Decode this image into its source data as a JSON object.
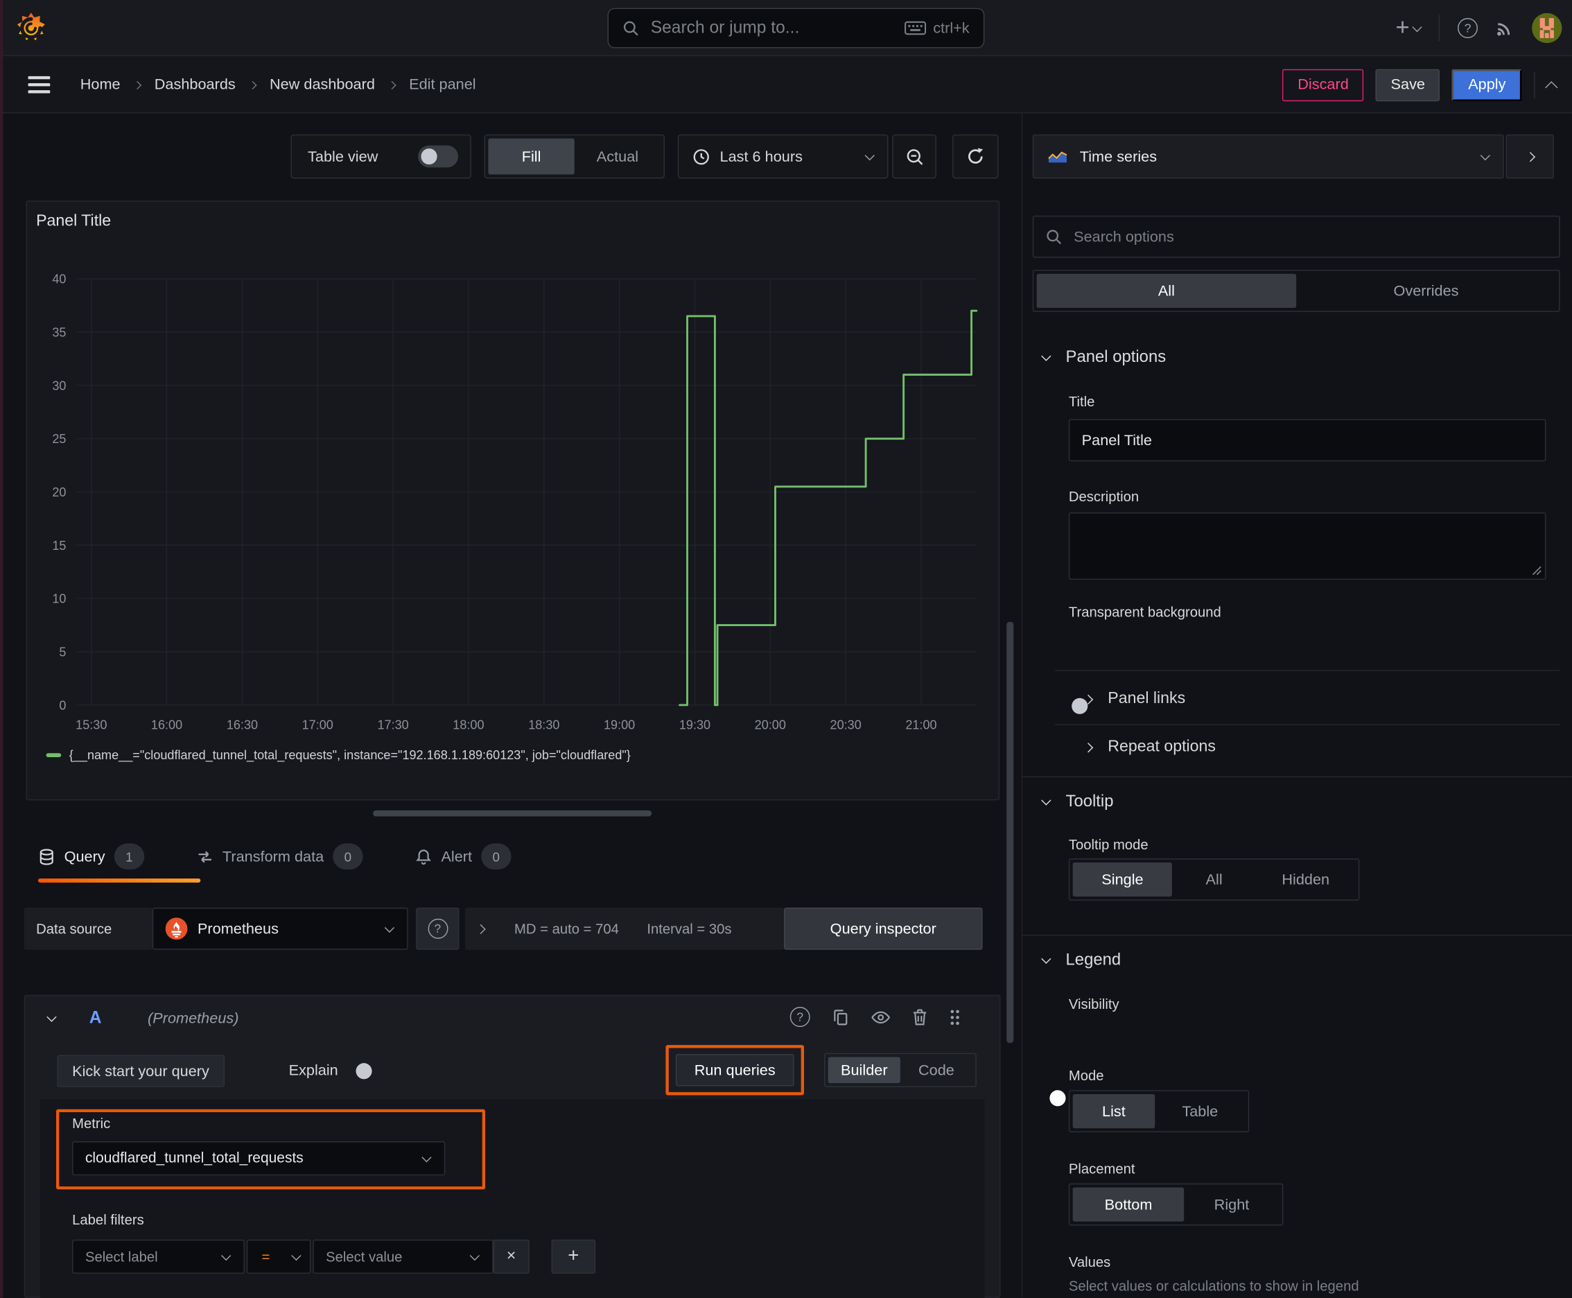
{
  "topbar": {
    "search_placeholder": "Search or jump to...",
    "search_shortcut": "ctrl+k"
  },
  "icons": {
    "plus": "+",
    "close": "×",
    "question": "?"
  },
  "breadcrumb": {
    "items": [
      "Home",
      "Dashboards",
      "New dashboard",
      "Edit panel"
    ]
  },
  "actions": {
    "discard": "Discard",
    "save": "Save",
    "apply": "Apply"
  },
  "toolbar": {
    "table_view": "Table view",
    "fill": "Fill",
    "actual": "Actual",
    "time_range": "Last 6 hours"
  },
  "panel": {
    "title": "Panel Title"
  },
  "chart_data": {
    "type": "line",
    "title": "Panel Title",
    "line_style": "stepped",
    "grid": true,
    "legend_position": "bottom",
    "x_range": [
      "15:24",
      "21:22"
    ],
    "x_ticks": [
      "15:30",
      "16:00",
      "16:30",
      "17:00",
      "17:30",
      "18:00",
      "18:30",
      "19:00",
      "19:30",
      "20:00",
      "20:30",
      "21:00"
    ],
    "ylim": [
      0,
      40
    ],
    "y_ticks": [
      0,
      5,
      10,
      15,
      20,
      25,
      30,
      35,
      40
    ],
    "series": [
      {
        "name": "{__name__=\"cloudflared_tunnel_total_requests\", instance=\"192.168.1.189:60123\", job=\"cloudflared\"}",
        "color": "#73bf69",
        "points": [
          [
            "19:24",
            0
          ],
          [
            "19:27",
            0
          ],
          [
            "19:27",
            36.5
          ],
          [
            "19:38",
            36.5
          ],
          [
            "19:38",
            0
          ],
          [
            "19:39",
            0
          ],
          [
            "19:39",
            7.5
          ],
          [
            "20:02",
            7.5
          ],
          [
            "20:02",
            20.5
          ],
          [
            "20:38",
            20.5
          ],
          [
            "20:38",
            25
          ],
          [
            "20:53",
            25
          ],
          [
            "20:53",
            31
          ],
          [
            "21:20",
            31
          ],
          [
            "21:20",
            37
          ],
          [
            "21:22",
            37
          ]
        ]
      }
    ]
  },
  "tabs": {
    "query": {
      "label": "Query",
      "count": "1"
    },
    "transform": {
      "label": "Transform data",
      "count": "0"
    },
    "alert": {
      "label": "Alert",
      "count": "0"
    }
  },
  "query_editor": {
    "datasource_label": "Data source",
    "datasource": "Prometheus",
    "stats_md": "MD = auto = 704",
    "stats_interval": "Interval = 30s",
    "inspector": "Query inspector",
    "ref_id": "A",
    "ref_ds": "(Prometheus)",
    "kick_start": "Kick start your query",
    "explain": "Explain",
    "run_queries": "Run queries",
    "builder": "Builder",
    "code": "Code",
    "metric_label": "Metric",
    "metric_value": "cloudflared_tunnel_total_requests",
    "label_filters_label": "Label filters",
    "select_label": "Select label",
    "operator": "=",
    "select_value": "Select value"
  },
  "sidebar": {
    "visualization": "Time series",
    "search_placeholder": "Search options",
    "tabs": {
      "all": "All",
      "overrides": "Overrides"
    },
    "panel_options": {
      "title": "Panel options",
      "title_label": "Title",
      "title_value": "Panel Title",
      "description_label": "Description",
      "transparent_label": "Transparent background"
    },
    "collapsed_sections": {
      "panel_links": "Panel links",
      "repeat_options": "Repeat options"
    },
    "tooltip": {
      "title": "Tooltip",
      "mode_label": "Tooltip mode",
      "options": [
        "Single",
        "All",
        "Hidden"
      ],
      "selected": "Single"
    },
    "legend": {
      "title": "Legend",
      "visibility_label": "Visibility",
      "mode_label": "Mode",
      "mode_options": [
        "List",
        "Table"
      ],
      "mode_selected": "List",
      "placement_label": "Placement",
      "placement_options": [
        "Bottom",
        "Right"
      ],
      "placement_selected": "Bottom",
      "values_label": "Values",
      "values_hint": "Select values or calculations to show in legend"
    }
  },
  "colors": {
    "accent_blue": "#3d71d9",
    "highlight_orange": "#e8590c",
    "series_green": "#73bf69",
    "discard_pink": "#e0226e",
    "prometheus_orange": "#e6522c"
  }
}
